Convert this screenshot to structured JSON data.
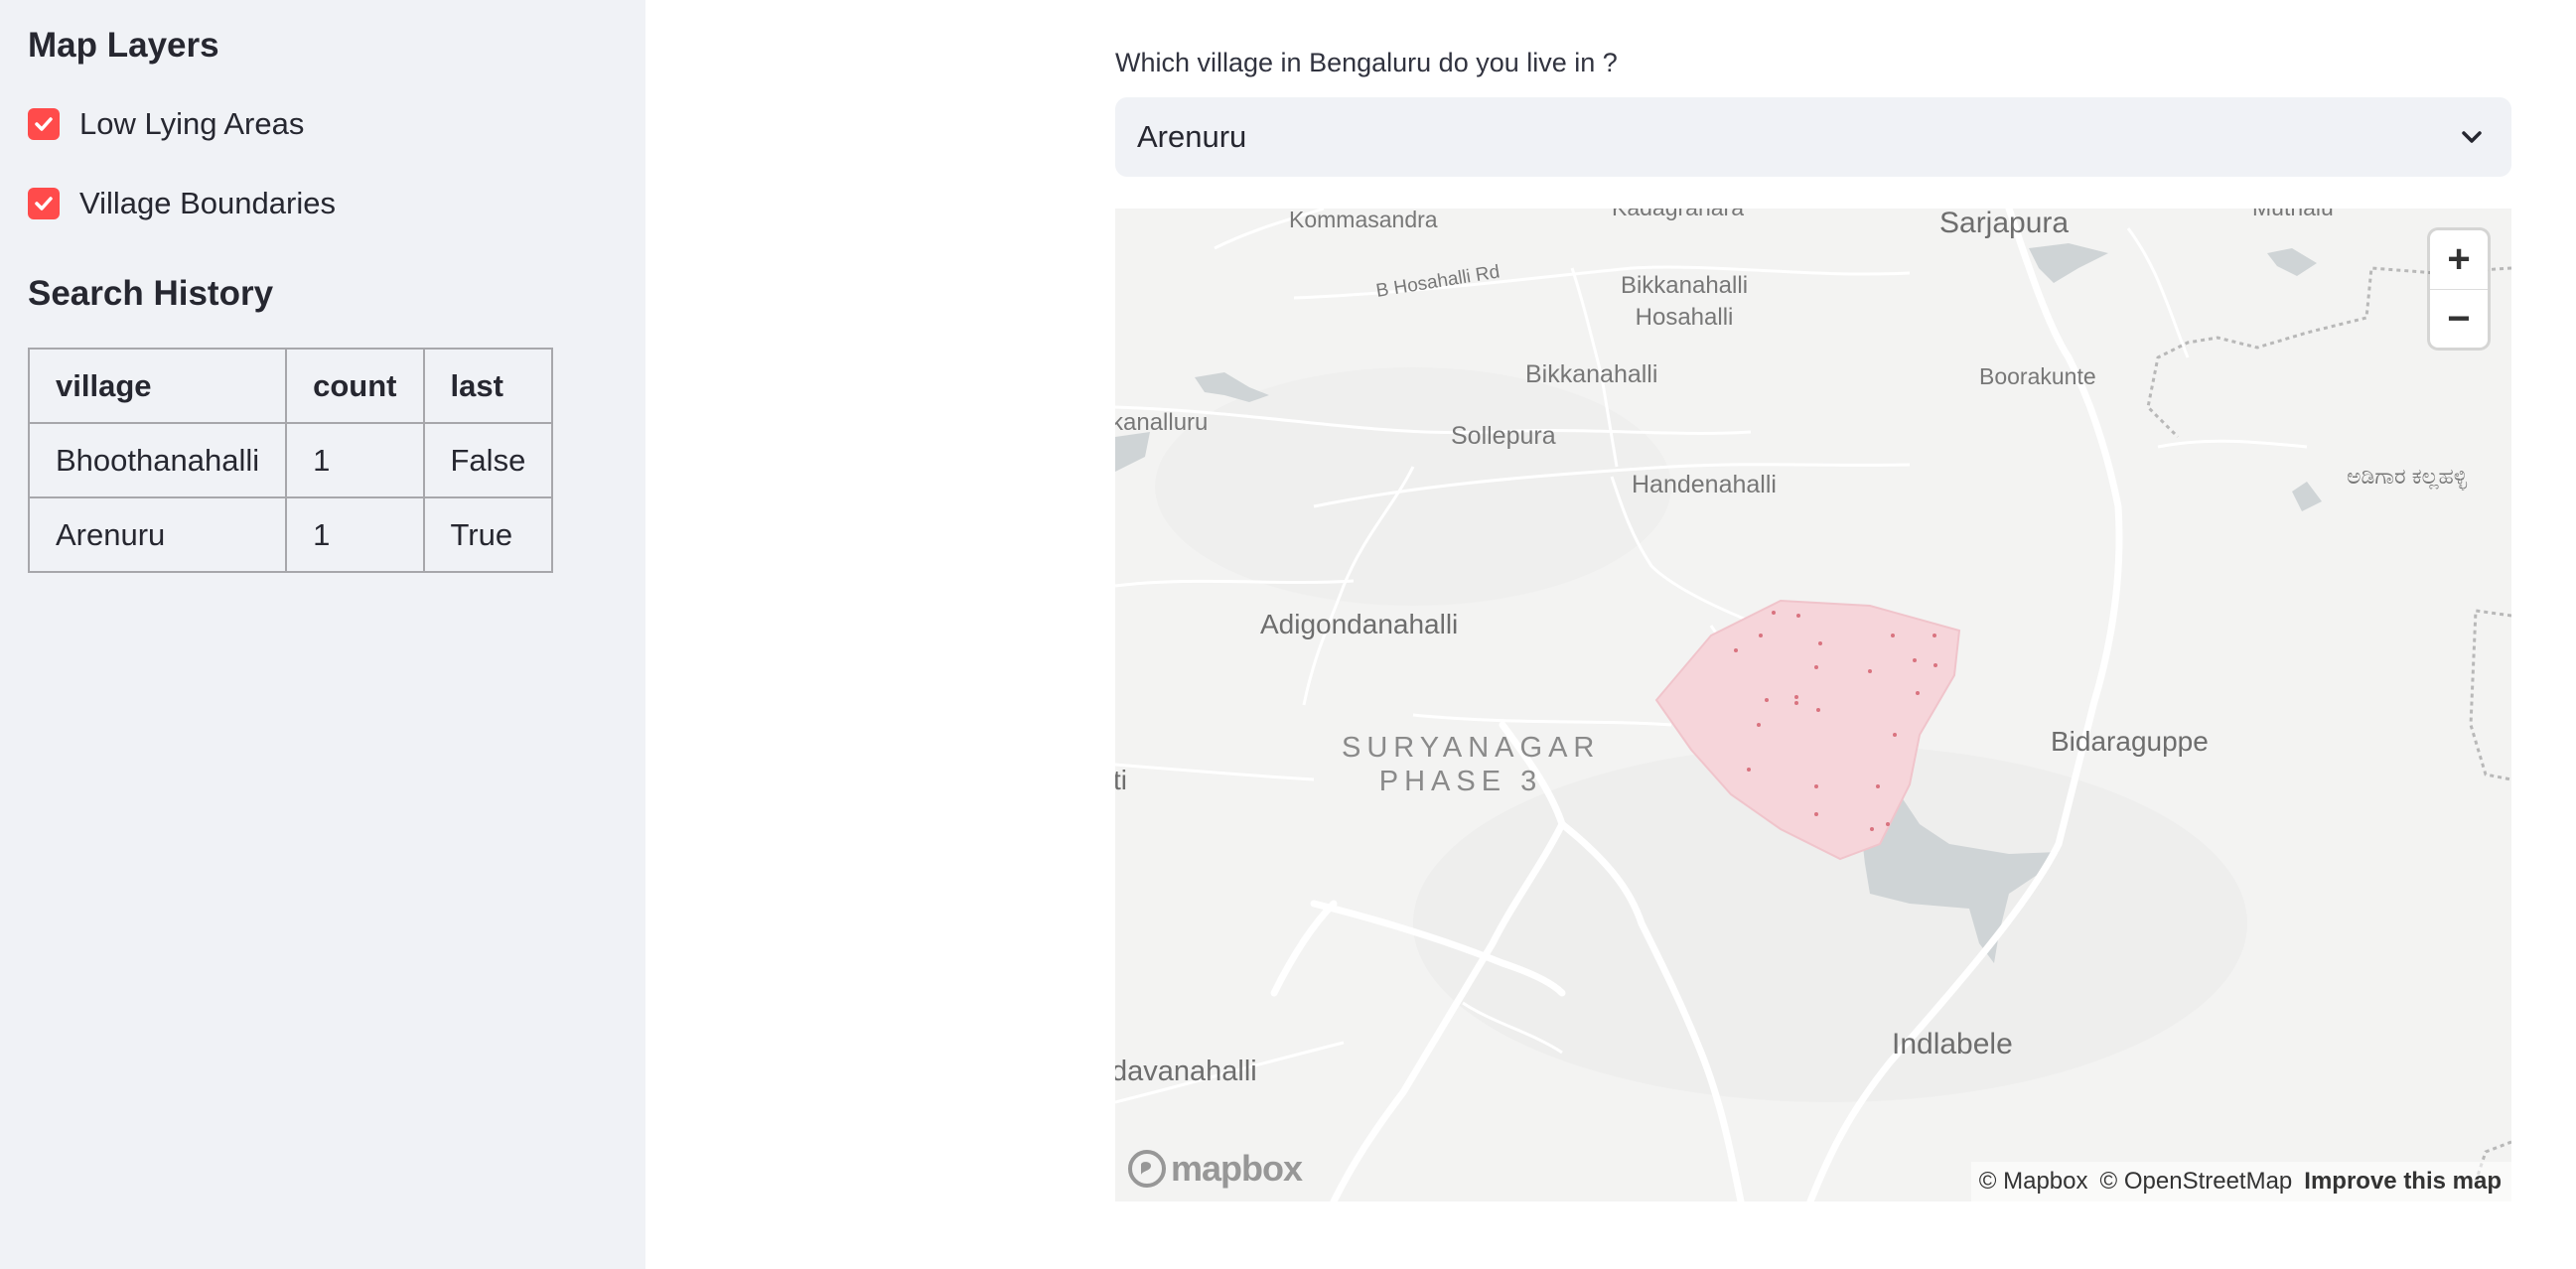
{
  "sidebar": {
    "map_layers_heading": "Map Layers",
    "layers": [
      {
        "label": "Low Lying Areas",
        "checked": true
      },
      {
        "label": "Village Boundaries",
        "checked": true
      }
    ],
    "search_history_heading": "Search History",
    "history_table": {
      "headers": [
        "village",
        "count",
        "last"
      ],
      "rows": [
        [
          "Bhoothanahalli",
          "1",
          "False"
        ],
        [
          "Arenuru",
          "1",
          "True"
        ]
      ]
    }
  },
  "main": {
    "question": "Which village in Bengaluru do you live in ?",
    "selected_village": "Arenuru"
  },
  "map": {
    "labels": {
      "kommasandra": "Kommasandra",
      "kadagrahara": "Kadagrahara",
      "sarjapura": "Sarjapura",
      "mutnalu": "Mutnalu",
      "b_hosahalli_rd": "B Hosahalli Rd",
      "bikkanahalli_hosahalli": "Bikkanahalli Hosahalli",
      "bikkanahalli": "Bikkanahalli",
      "boorakunte": "Boorakunte",
      "kanalluru": "kanalluru",
      "sollepura": "Sollepura",
      "handenahalli": "Handenahalli",
      "kannada_label": "ಅಡಿಗಾರ ಕಲ್ಲಹಳ್ಳಿ",
      "adigondanahalli": "Adigondanahalli",
      "suryanagar_line1": "SURYANAGAR",
      "suryanagar_line2": "PHASE 3",
      "bidaraguppe": "Bidaraguppe",
      "ti": "ti",
      "indlabele": "Indlabele",
      "davanahalli": "davanahalli"
    },
    "zoom_in": "+",
    "zoom_out": "−",
    "logo_text": "mapbox",
    "attribution_mapbox": "© Mapbox",
    "attribution_osm": "© OpenStreetMap",
    "attribution_improve": "Improve this map",
    "colors": {
      "boundary_fill": "#f6d5da",
      "water": "#cfd4d6",
      "road": "#ffffff",
      "checkbox": "#ff4b4b"
    }
  }
}
